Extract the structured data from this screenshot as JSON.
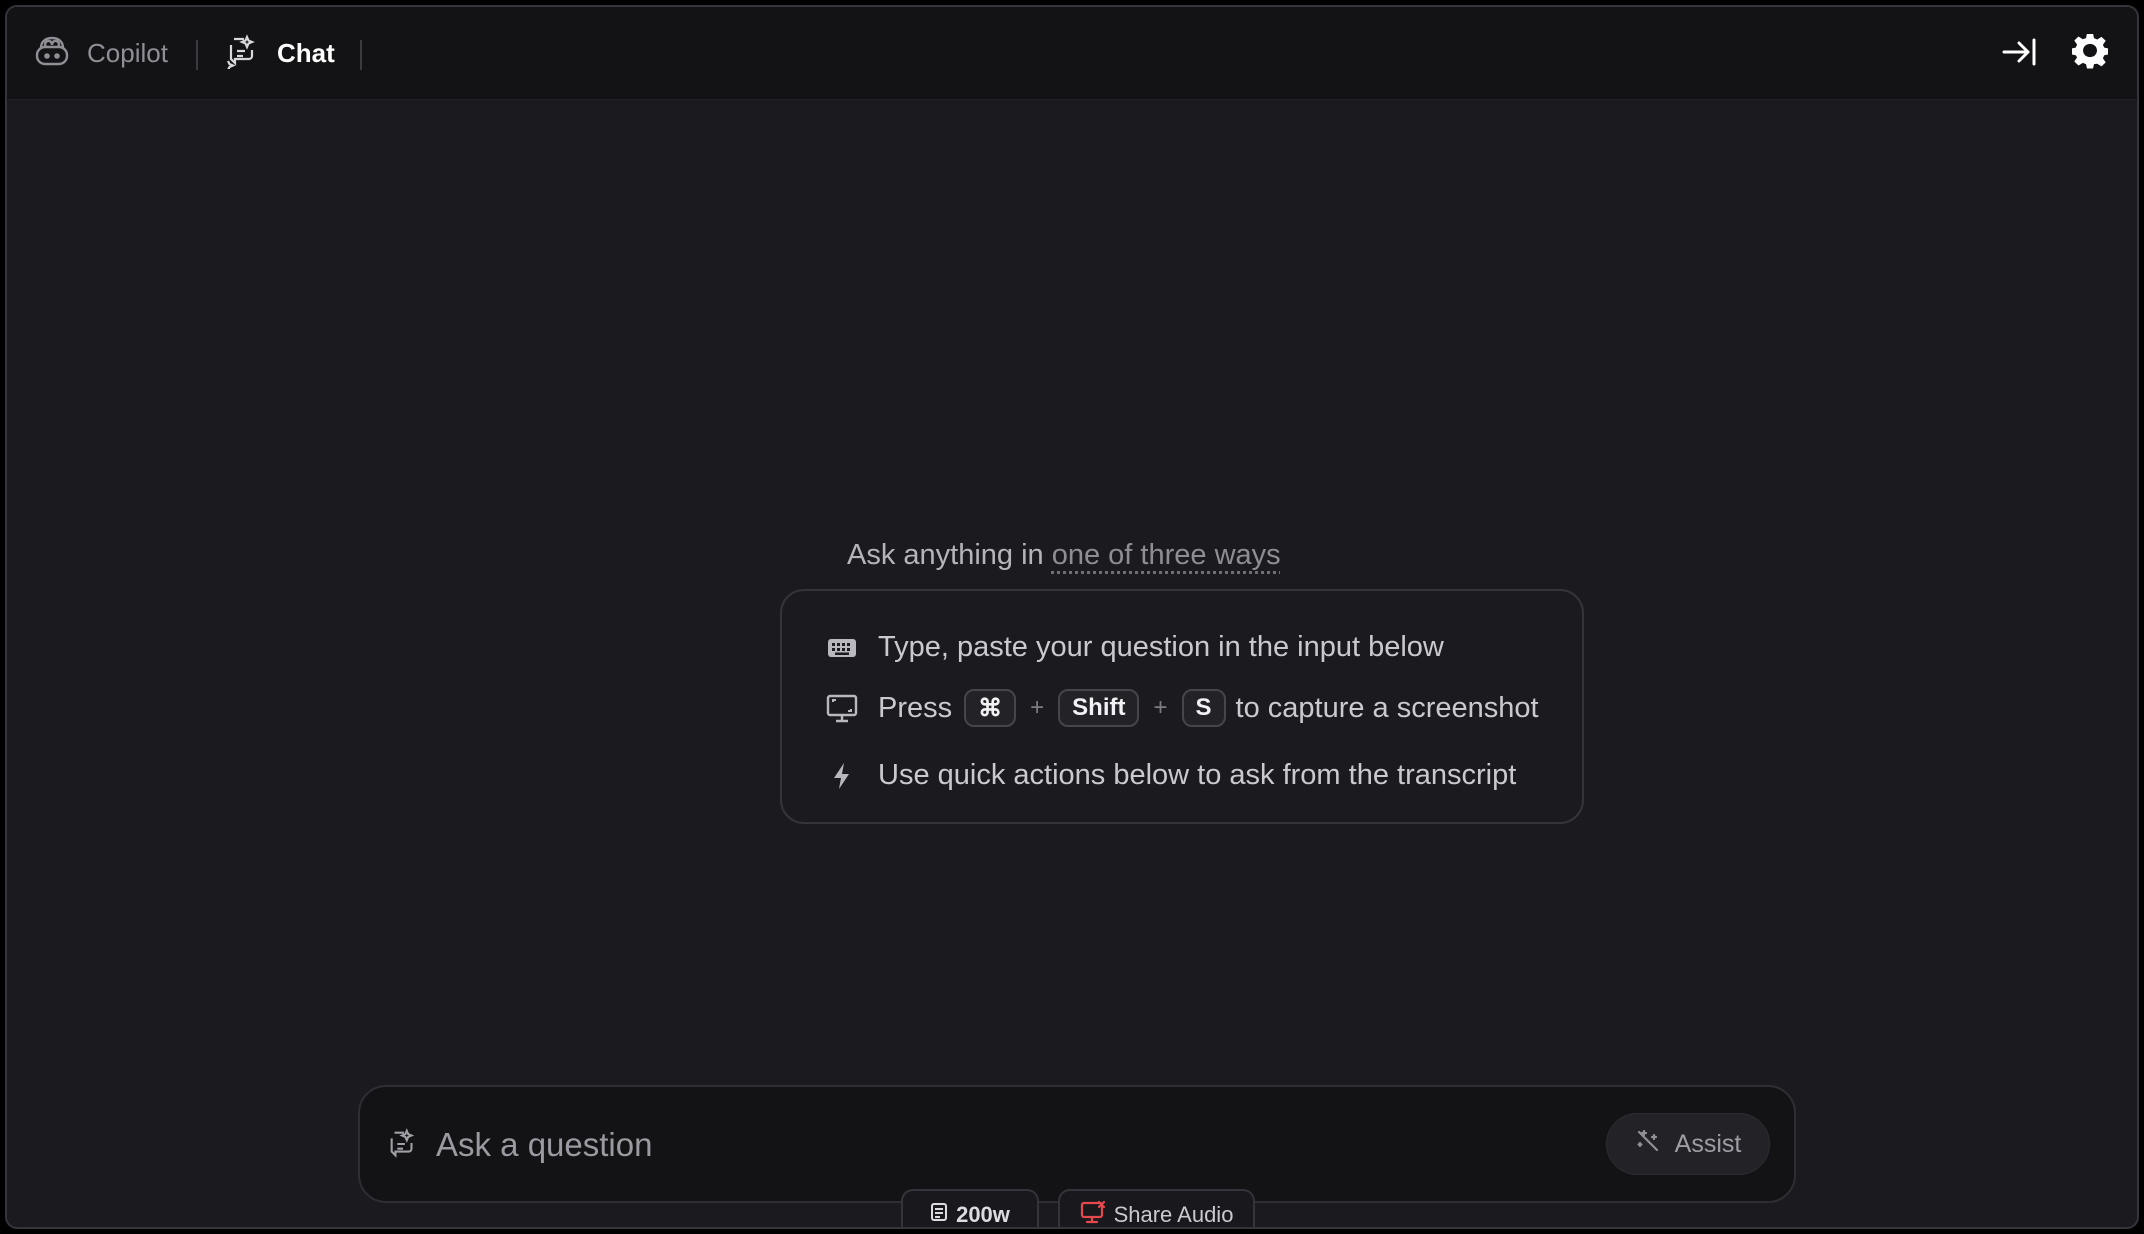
{
  "header": {
    "tabs": [
      {
        "label": "Copilot",
        "icon": "copilot-icon",
        "active": false
      },
      {
        "label": "Chat",
        "icon": "chat-sparkle-icon",
        "active": true
      }
    ],
    "actions": [
      "collapse-panel-icon",
      "gear-icon"
    ]
  },
  "intro": {
    "prefix": "Ask anything in ",
    "link": "one of three ways"
  },
  "ways": {
    "type_text": "Type, paste your question in the input below",
    "press_label": "Press",
    "keys": [
      "⌘",
      "Shift",
      "S"
    ],
    "plus": "+",
    "capture_text": "to capture a screenshot",
    "quick_text": "Use quick actions below to ask from the transcript"
  },
  "composer": {
    "placeholder": "Ask a question",
    "assist_label": "Assist"
  },
  "footer": {
    "word_count": "200w",
    "share_audio": "Share Audio"
  },
  "colors": {
    "background": "#1b1b1f",
    "topbar": "#131316",
    "share_audio_icon": "#e5484d"
  }
}
